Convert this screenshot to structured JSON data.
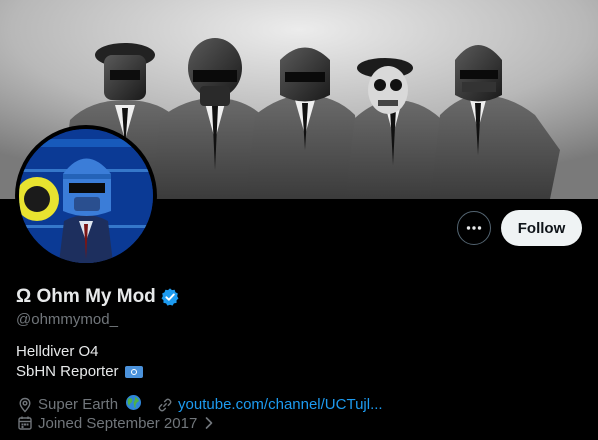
{
  "profile": {
    "display_name": "Ω Ohm My Mod",
    "handle": "@ohmmymod_",
    "verified_icon": "verified-badge-icon",
    "bio_line1": "Helldiver O4",
    "bio_line2": "SbHN Reporter",
    "bio_flag_icon": "un-flag-icon",
    "location": "Super Earth",
    "location_icon": "location-pin-icon",
    "location_emoji_icon": "globe-icon",
    "website": "youtube.com/channel/UCTujl...",
    "website_icon": "link-icon",
    "joined": "Joined September 2017",
    "joined_icon": "calendar-icon"
  },
  "actions": {
    "more_icon": "more-options-icon",
    "follow_label": "Follow"
  },
  "colors": {
    "background": "#000000",
    "accent_blue": "#1d9bf0",
    "muted_text": "#71767b",
    "primary_text": "#e7e9ea",
    "follow_bg": "#eff3f4"
  }
}
